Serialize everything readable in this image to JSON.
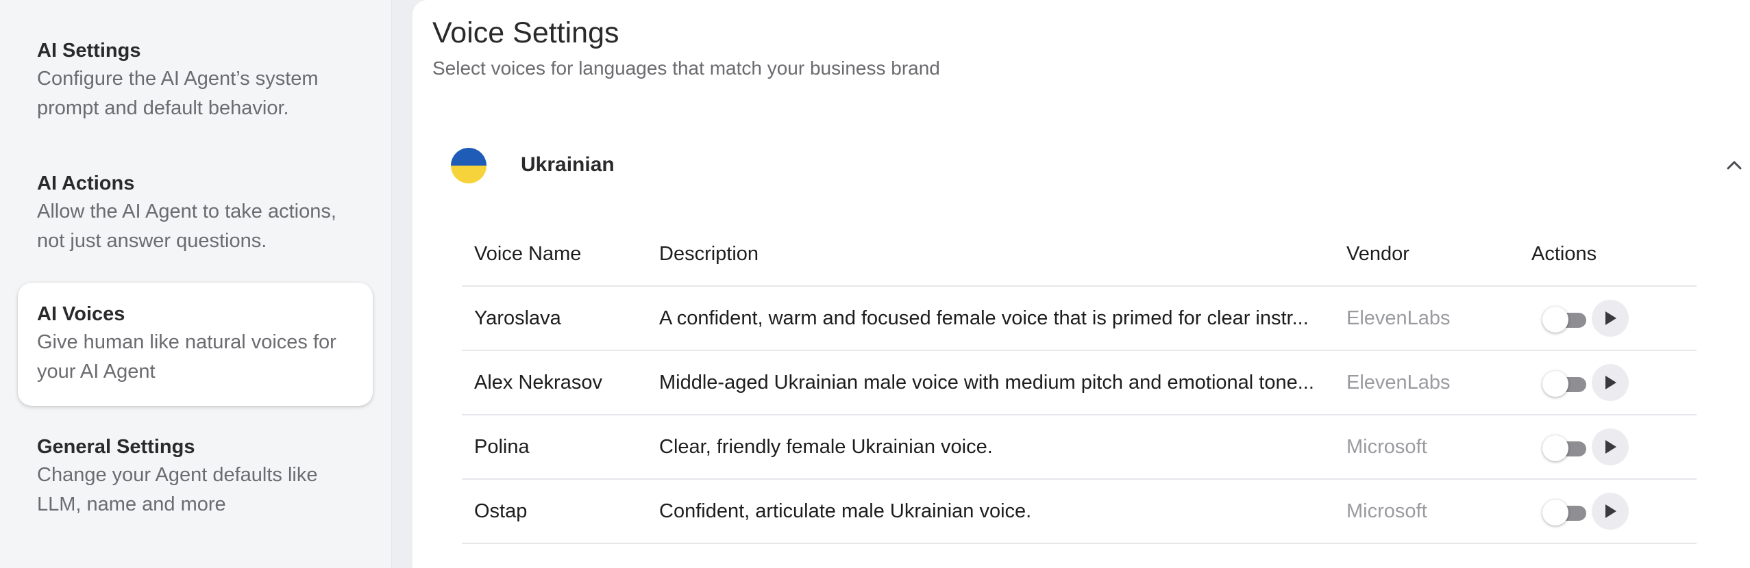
{
  "sidebar": {
    "items": [
      {
        "title": "AI Settings",
        "description": "Configure the AI Agent’s system prompt and default behavior.",
        "active": false
      },
      {
        "title": "AI Actions",
        "description": "Allow the AI Agent to take actions, not just answer questions.",
        "active": false
      },
      {
        "title": "AI Voices",
        "description": "Give human like natural voices for your AI Agent",
        "active": true
      },
      {
        "title": "General Settings",
        "description": "Change your Agent defaults like LLM, name and more",
        "active": false
      }
    ]
  },
  "main": {
    "title": "Voice Settings",
    "subtitle": "Select voices for languages that match your business brand",
    "language": {
      "name": "Ukrainian",
      "flag_colors": [
        "#1f5cb8",
        "#f6d33a"
      ],
      "expanded": true,
      "table": {
        "headers": {
          "name": "Voice Name",
          "description": "Description",
          "vendor": "Vendor",
          "actions": "Actions"
        },
        "rows": [
          {
            "name": "Yaroslava",
            "description": "A confident, warm and focused female voice that is primed for clear instr...",
            "vendor": "ElevenLabs",
            "enabled": false
          },
          {
            "name": "Alex Nekrasov",
            "description": "Middle-aged Ukrainian male voice with medium pitch and emotional tone...",
            "vendor": "ElevenLabs",
            "enabled": false
          },
          {
            "name": "Polina",
            "description": "Clear, friendly female Ukrainian voice.",
            "vendor": "Microsoft",
            "enabled": false
          },
          {
            "name": "Ostap",
            "description": "Confident, articulate male Ukrainian voice.",
            "vendor": "Microsoft",
            "enabled": false
          }
        ]
      }
    }
  },
  "icons": {
    "chevron": "chevron-up-icon",
    "play": "play-icon",
    "toggle": "toggle-switch"
  }
}
